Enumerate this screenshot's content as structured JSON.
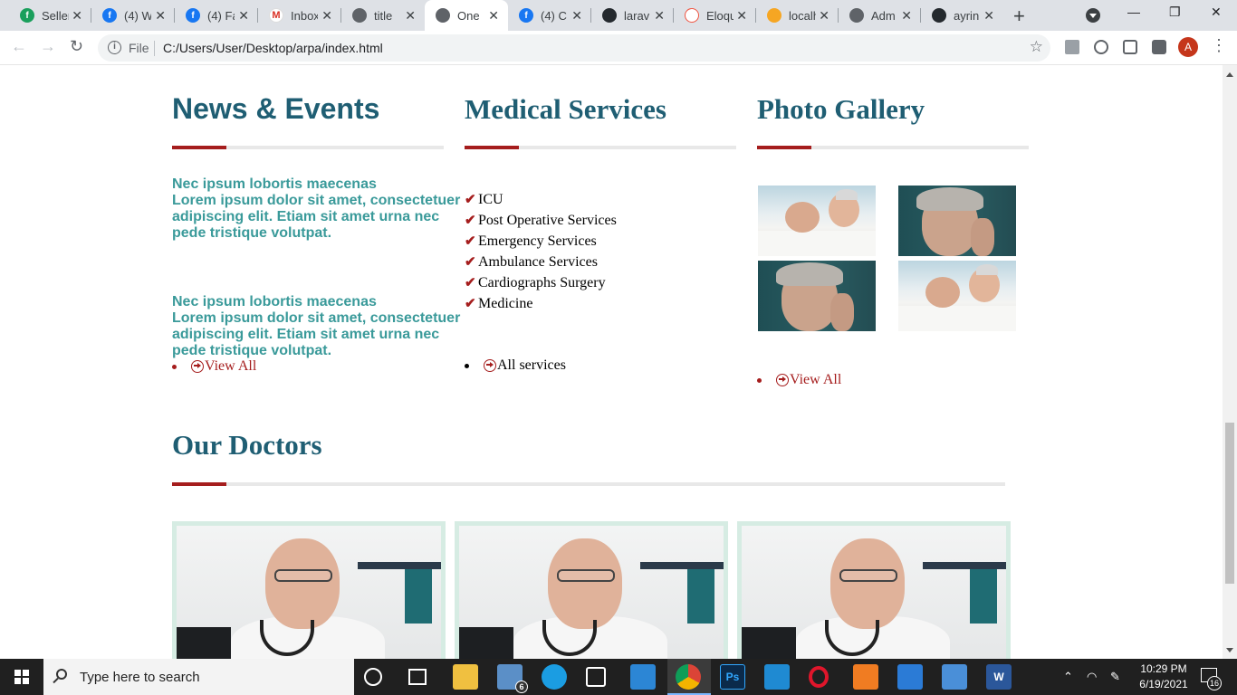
{
  "browser": {
    "tabs": [
      {
        "label": "Seller",
        "icon": "green-logo-icon"
      },
      {
        "label": "(4) W",
        "icon": "facebook-icon"
      },
      {
        "label": "(4) Fa",
        "icon": "facebook-icon"
      },
      {
        "label": "Inbox",
        "icon": "gmail-icon"
      },
      {
        "label": "title",
        "icon": "globe-icon"
      },
      {
        "label": "One",
        "icon": "globe-icon",
        "active": true
      },
      {
        "label": "(4) C",
        "icon": "facebook-icon"
      },
      {
        "label": "larav",
        "icon": "github-icon"
      },
      {
        "label": "Eloqu",
        "icon": "laravel-icon"
      },
      {
        "label": "localh",
        "icon": "phpmyadmin-icon"
      },
      {
        "label": "Adm",
        "icon": "globe-icon"
      },
      {
        "label": "ayrin",
        "icon": "github-icon"
      }
    ],
    "scheme_label": "File",
    "url": "C:/Users/User/Desktop/arpa/index.html",
    "profile_initial": "A"
  },
  "page": {
    "news": {
      "title": "News & Events",
      "items": [
        {
          "heading": "Nec ipsum lobortis maecenas",
          "body": "Lorem ipsum dolor sit amet, consectetuer adipiscing elit. Etiam sit amet urna nec pede tristique volutpat."
        },
        {
          "heading": "Nec ipsum lobortis maecenas",
          "body": "Lorem ipsum dolor sit amet, consectetuer adipiscing elit. Etiam sit amet urna nec pede tristique volutpat."
        }
      ],
      "view_all": "View All"
    },
    "services": {
      "title": "Medical Services",
      "items": [
        "ICU",
        "Post Operative Services",
        "Emergency Services",
        "Ambulance Services",
        "Cardiographs Surgery",
        "Medicine"
      ],
      "all_link": "All services"
    },
    "gallery": {
      "title": "Photo Gallery",
      "view_all": "View All"
    },
    "doctors": {
      "title": "Our Doctors"
    }
  },
  "taskbar": {
    "search_placeholder": "Type here to search",
    "time": "10:29 PM",
    "date": "6/19/2021",
    "mail_badge": "6",
    "notification_count": "16"
  },
  "colors": {
    "heading": "#1f5e73",
    "accent": "#a51d1d",
    "news_text": "#3a9a9a"
  }
}
